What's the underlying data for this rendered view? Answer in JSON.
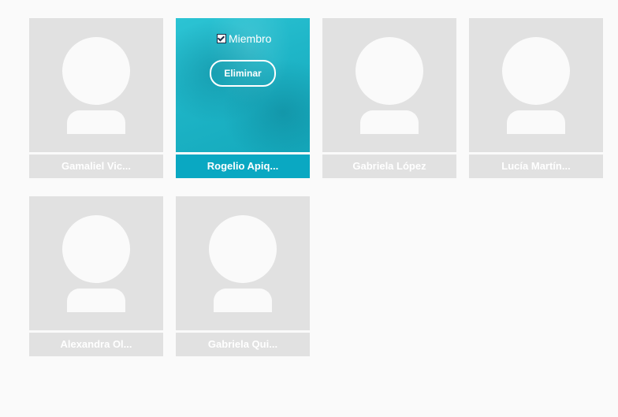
{
  "members": [
    {
      "name": "Gamaliel Vic...",
      "selected": false
    },
    {
      "name": "Rogelio Apiq...",
      "selected": true
    },
    {
      "name": "Gabriela López",
      "selected": false
    },
    {
      "name": "Lucía Martín...",
      "selected": false
    },
    {
      "name": "Alexandra Ol...",
      "selected": false
    },
    {
      "name": "Gabriela Qui...",
      "selected": false
    }
  ],
  "overlay": {
    "member_label": "Miembro",
    "member_checked": true,
    "remove_label": "Eliminar"
  },
  "colors": {
    "selected_accent": "#0aa8c2",
    "placeholder_bg": "#e1e1e1"
  }
}
